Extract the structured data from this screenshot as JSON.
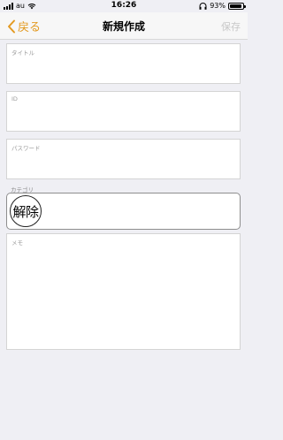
{
  "status_bar": {
    "carrier": "au",
    "time": "16:26",
    "battery_percent": "93%",
    "battery_level": 0.93
  },
  "nav": {
    "back_label": "戻る",
    "title": "新規作成",
    "save_label": "保存"
  },
  "form": {
    "title_placeholder": "タイトル",
    "id_placeholder": "ID",
    "password_placeholder": "パスワード",
    "category_label": "カテゴリ",
    "category_clear": "解除",
    "memo_placeholder": "メモ"
  },
  "colors": {
    "accent": "#e39a21",
    "disabled": "#c8c8c8",
    "background": "#efeff4"
  }
}
